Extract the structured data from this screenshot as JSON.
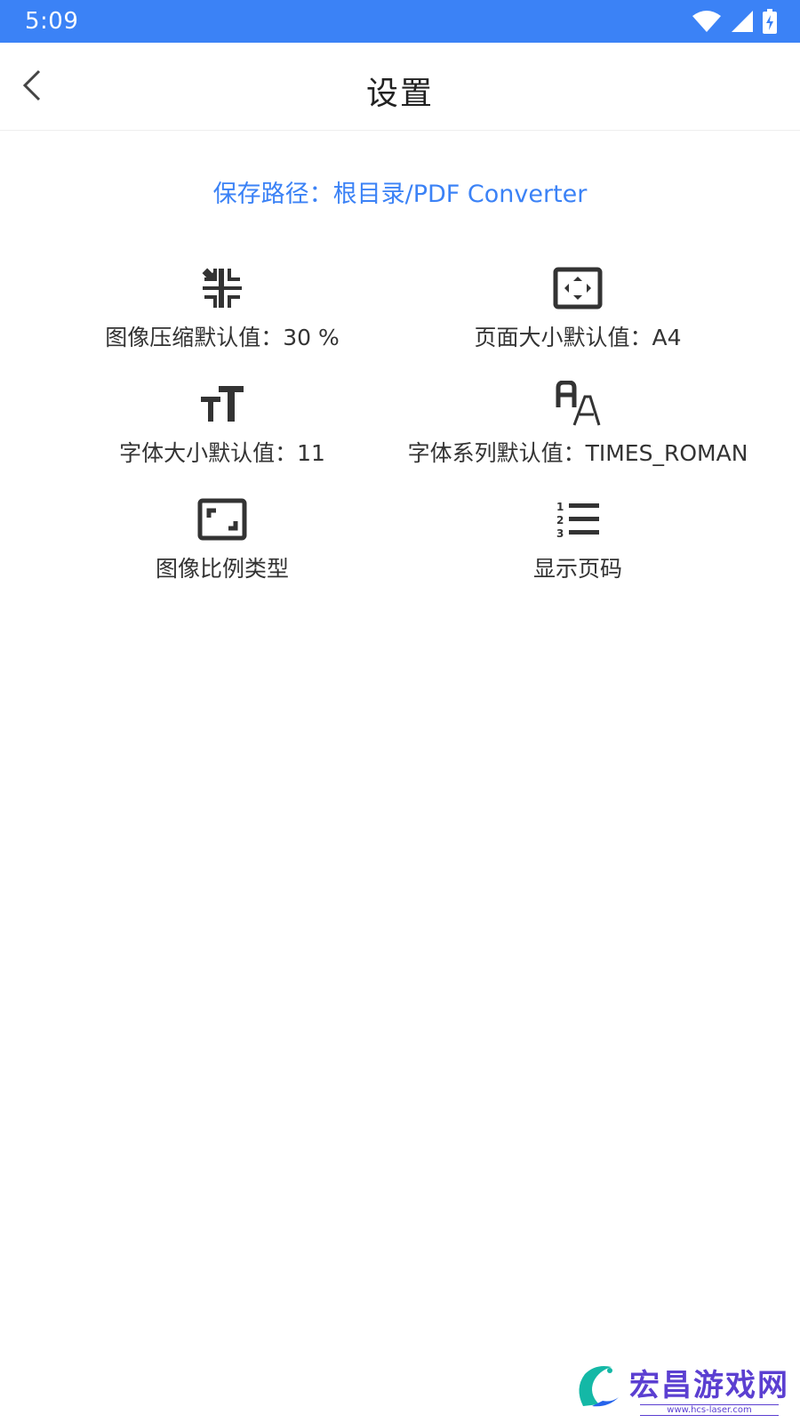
{
  "status_bar": {
    "time": "5:09",
    "icons": [
      "wifi-icon",
      "cellular-signal-icon",
      "battery-charging-icon"
    ]
  },
  "app_bar": {
    "title": "设置",
    "back_icon": "chevron-left-icon"
  },
  "save_path": {
    "text": "保存路径：根目录/PDF Converter"
  },
  "settings": [
    {
      "icon": "compress-icon",
      "label": "图像压缩默认值：30 %"
    },
    {
      "icon": "page-size-icon",
      "label": "页面大小默认值：A4"
    },
    {
      "icon": "font-size-icon",
      "label": "字体大小默认值：11"
    },
    {
      "icon": "font-family-icon",
      "label": "字体系列默认值：TIMES_ROMAN"
    },
    {
      "icon": "aspect-ratio-icon",
      "label": "图像比例类型"
    },
    {
      "icon": "numbered-list-icon",
      "label": "显示页码"
    }
  ],
  "watermark": {
    "name": "宏昌游戏网",
    "url": "www.hcs-laser.com"
  },
  "colors": {
    "accent": "#3b82f6",
    "text": "#333333",
    "watermark": "#5b3fd1"
  }
}
